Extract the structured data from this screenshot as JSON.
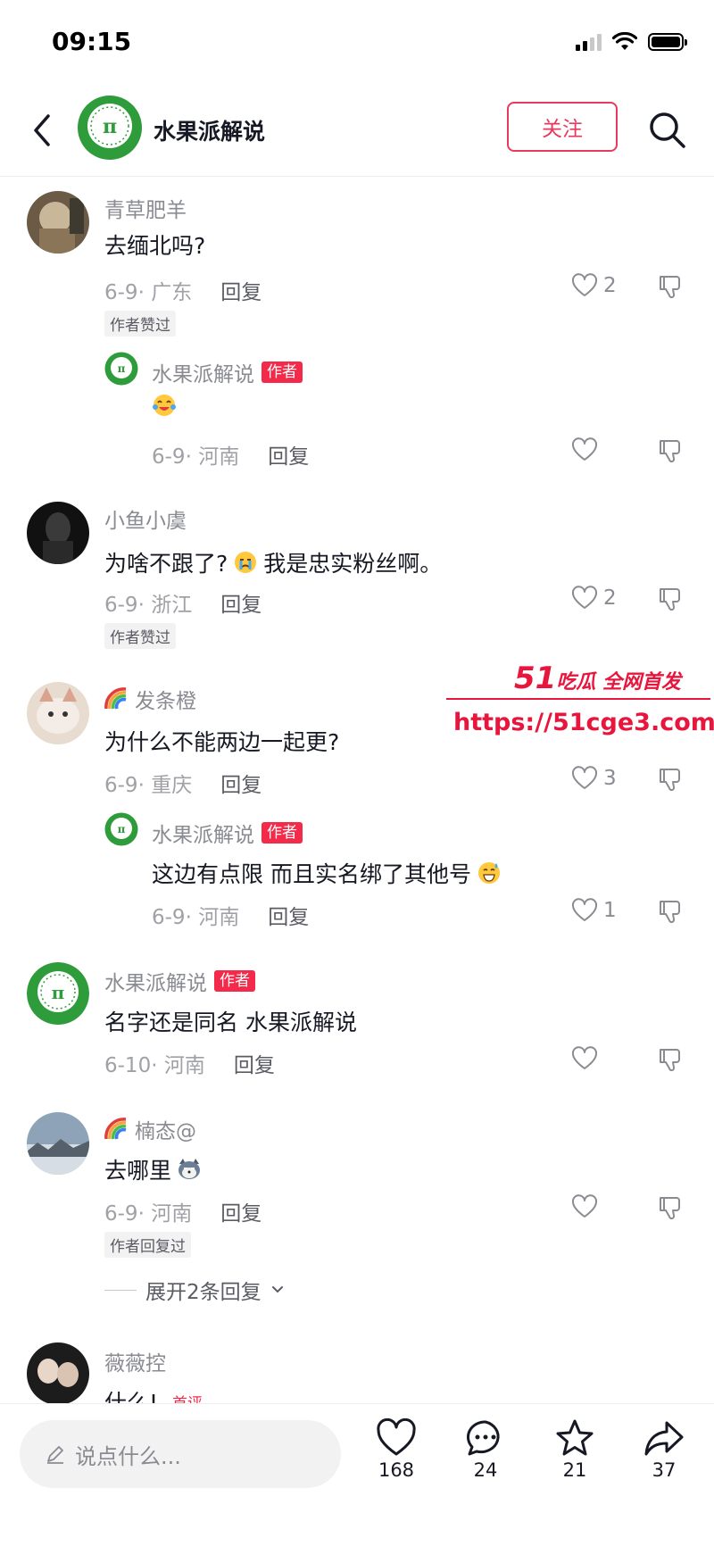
{
  "status_bar": {
    "time": "09:15"
  },
  "header": {
    "title": "水果派解说",
    "follow_label": "关注"
  },
  "comments": [
    {
      "name": "青草肥羊",
      "text": "去缅北吗?",
      "date_loc": "6-9· 广东",
      "reply_label": "回复",
      "likes": "2",
      "badge": "作者赞过",
      "reply": {
        "name": "水果派解说",
        "author_tag": "作者",
        "date_loc": "6-9· 河南",
        "reply_label": "回复",
        "likes": ""
      }
    },
    {
      "name": "小鱼小虞",
      "text_a": "为啥不跟了?",
      "text_b": "我是忠实粉丝啊。",
      "date_loc": "6-9· 浙江",
      "reply_label": "回复",
      "likes": "2",
      "badge": "作者赞过"
    },
    {
      "name": "发条橙",
      "text": "为什么不能两边一起更?",
      "date_loc": "6-9· 重庆",
      "reply_label": "回复",
      "likes": "3",
      "reply": {
        "name": "水果派解说",
        "author_tag": "作者",
        "text": "这边有点限 而且实名绑了其他号",
        "date_loc": "6-9· 河南",
        "reply_label": "回复",
        "likes": "1"
      }
    },
    {
      "name": "水果派解说",
      "author_tag": "作者",
      "text": "名字还是同名 水果派解说",
      "date_loc": "6-10· 河南",
      "reply_label": "回复",
      "likes": ""
    },
    {
      "name": "楠态@",
      "text": "去哪里",
      "date_loc": "6-9· 河南",
      "reply_label": "回复",
      "likes": "",
      "badge": "作者回复过",
      "expand_label": "展开2条回复"
    },
    {
      "name": "薇薇控",
      "text": "什么!",
      "first_tag": "首评"
    }
  ],
  "watermark": {
    "title_num": "51",
    "title_text": "吃瓜 全网首发",
    "url": "https://51cge3.com"
  },
  "bottom_bar": {
    "input_placeholder": "说点什么...",
    "like_count": "168",
    "comment_count": "24",
    "favorite_count": "21",
    "share_count": "37"
  },
  "colors": {
    "accent": "#e83a5c",
    "author_tag": "#f42a4a",
    "watermark": "#e8153d"
  }
}
